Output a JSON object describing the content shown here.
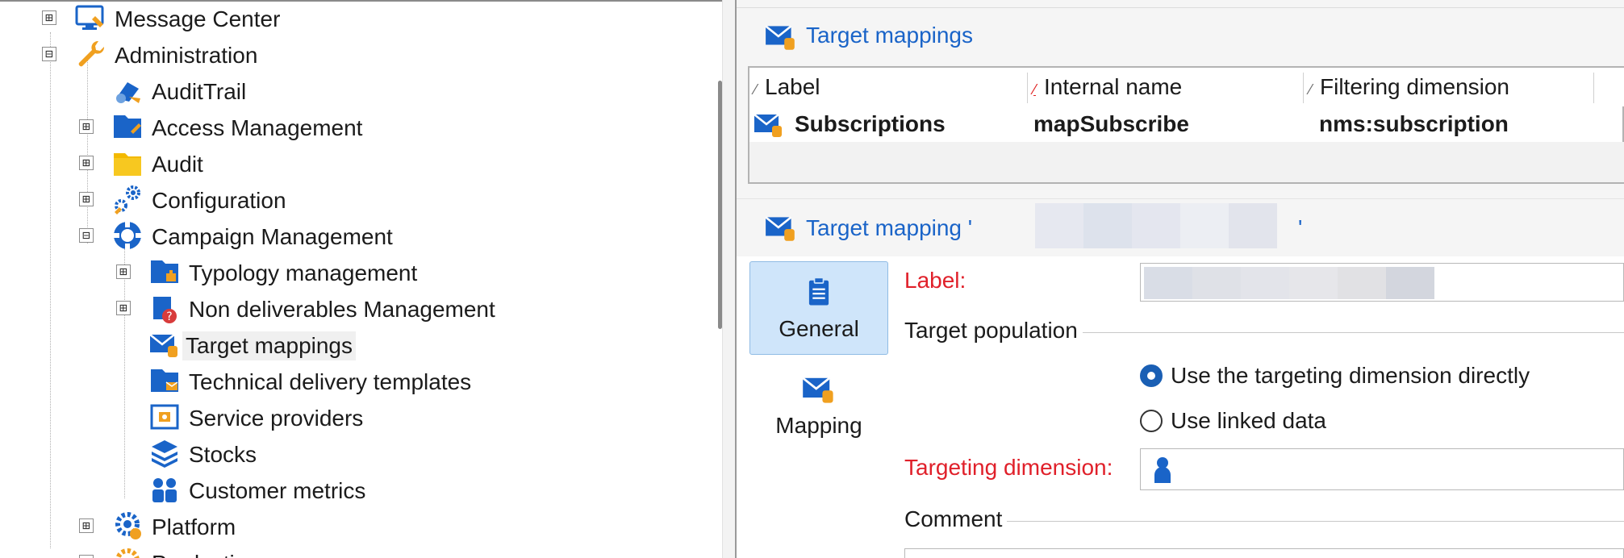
{
  "tree": {
    "items": [
      {
        "label": "Message Center",
        "expander": "⊞"
      },
      {
        "label": "Administration",
        "expander": "⊟"
      },
      {
        "label": "AuditTrail"
      },
      {
        "label": "Access Management",
        "expander": "⊞"
      },
      {
        "label": "Audit",
        "expander": "⊞"
      },
      {
        "label": "Configuration",
        "expander": "⊞"
      },
      {
        "label": "Campaign Management",
        "expander": "⊟"
      },
      {
        "label": "Typology management",
        "expander": "⊞"
      },
      {
        "label": "Non deliverables Management",
        "expander": "⊞"
      },
      {
        "label": "Target mappings",
        "selected": true
      },
      {
        "label": "Technical delivery templates"
      },
      {
        "label": "Service providers"
      },
      {
        "label": "Stocks"
      },
      {
        "label": "Customer metrics"
      },
      {
        "label": "Platform",
        "expander": "⊞"
      },
      {
        "label": "Production",
        "expander": "⊞"
      }
    ]
  },
  "list": {
    "title": "Target mappings",
    "columns": [
      {
        "label": "Label",
        "sort_mark": "⁄"
      },
      {
        "label": "Internal name",
        "sort_mark": "⁄"
      },
      {
        "label": "Filtering dimension",
        "sort_mark": "⁄"
      }
    ],
    "rows": [
      {
        "label": "Subscriptions",
        "internal_name": "mapSubscribe",
        "filtering_dimension": "nms:subscription"
      }
    ]
  },
  "detail": {
    "title_prefix": "Target mapping '",
    "title_suffix": "'",
    "tabs": [
      {
        "label": "General",
        "active": true
      },
      {
        "label": "Mapping",
        "active": false
      }
    ],
    "form": {
      "label_caption": "Label:",
      "target_population_title": "Target population",
      "radio_direct": "Use the targeting dimension directly",
      "radio_linked": "Use linked data",
      "targeting_dimension_caption": "Targeting dimension:",
      "comment_title": "Comment"
    }
  },
  "colors": {
    "link_blue": "#1a64c8",
    "required_red": "#e0202a",
    "tab_active_bg": "#cfe5fa",
    "radio_blue": "#1a5fb4"
  }
}
